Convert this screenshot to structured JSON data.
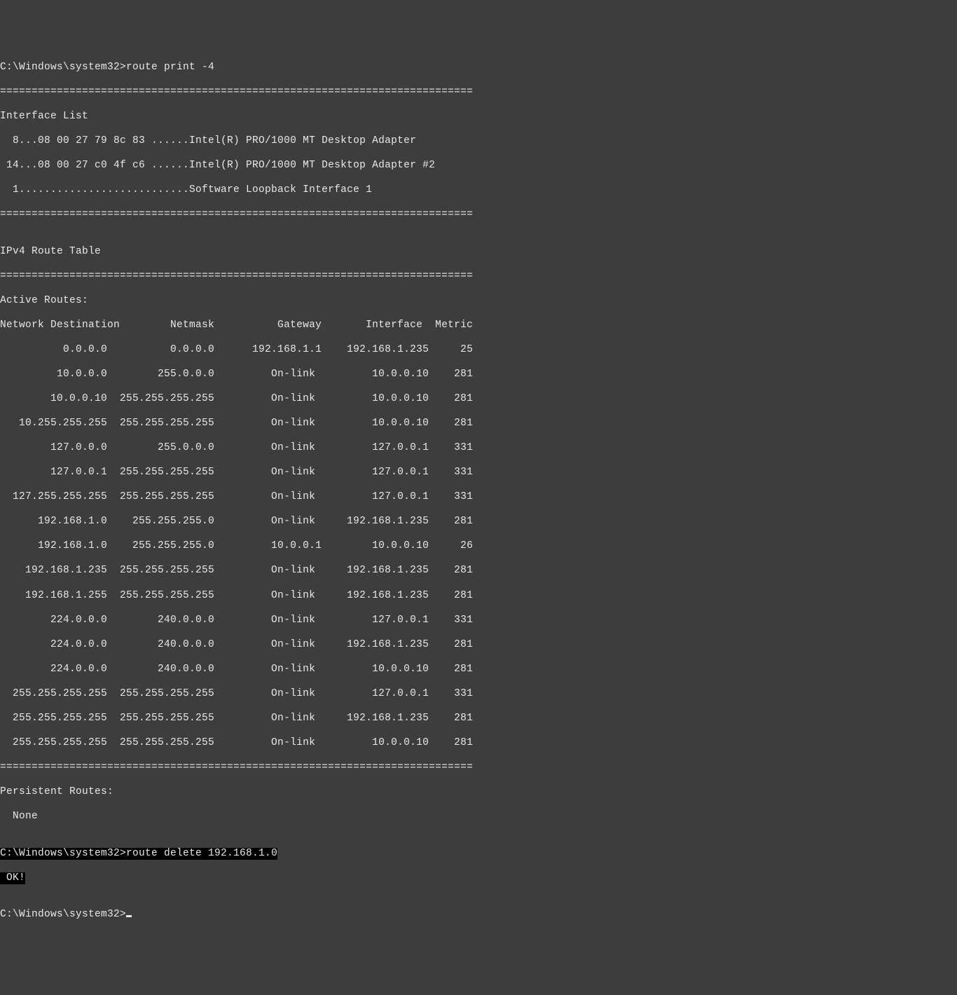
{
  "prompt1_path": "C:\\Windows\\system32>",
  "command1": "route print -4",
  "divider": "===========================================================================",
  "iface_header": "Interface List",
  "iface1": "  8...08 00 27 79 8c 83 ......Intel(R) PRO/1000 MT Desktop Adapter",
  "iface2": " 14...08 00 27 c0 4f c6 ......Intel(R) PRO/1000 MT Desktop Adapter #2",
  "iface3": "  1...........................Software Loopback Interface 1",
  "blank": "",
  "table_title": "IPv4 Route Table",
  "active_routes": "Active Routes:",
  "columns": "Network Destination        Netmask          Gateway       Interface  Metric",
  "r01": "          0.0.0.0          0.0.0.0      192.168.1.1    192.168.1.235     25",
  "r02": "         10.0.0.0        255.0.0.0         On-link         10.0.0.10    281",
  "r03": "        10.0.0.10  255.255.255.255         On-link         10.0.0.10    281",
  "r04": "   10.255.255.255  255.255.255.255         On-link         10.0.0.10    281",
  "r05": "        127.0.0.0        255.0.0.0         On-link         127.0.0.1    331",
  "r06": "        127.0.0.1  255.255.255.255         On-link         127.0.0.1    331",
  "r07": "  127.255.255.255  255.255.255.255         On-link         127.0.0.1    331",
  "r08": "      192.168.1.0    255.255.255.0         On-link     192.168.1.235    281",
  "r09": "      192.168.1.0    255.255.255.0         10.0.0.1        10.0.0.10     26",
  "r10": "    192.168.1.235  255.255.255.255         On-link     192.168.1.235    281",
  "r11": "    192.168.1.255  255.255.255.255         On-link     192.168.1.235    281",
  "r12": "        224.0.0.0        240.0.0.0         On-link         127.0.0.1    331",
  "r13": "        224.0.0.0        240.0.0.0         On-link     192.168.1.235    281",
  "r14": "        224.0.0.0        240.0.0.0         On-link         10.0.0.10    281",
  "r15": "  255.255.255.255  255.255.255.255         On-link         127.0.0.1    331",
  "r16": "  255.255.255.255  255.255.255.255         On-link     192.168.1.235    281",
  "r17": "  255.255.255.255  255.255.255.255         On-link         10.0.0.10    281",
  "persistent": "Persistent Routes:",
  "none": "  None",
  "hl_prompt": "C:\\Windows\\system32>",
  "hl_cmd": "route delete 192.168.1.0",
  "hl_ok": " OK!",
  "prompt3_path": "C:\\Windows\\system32>"
}
